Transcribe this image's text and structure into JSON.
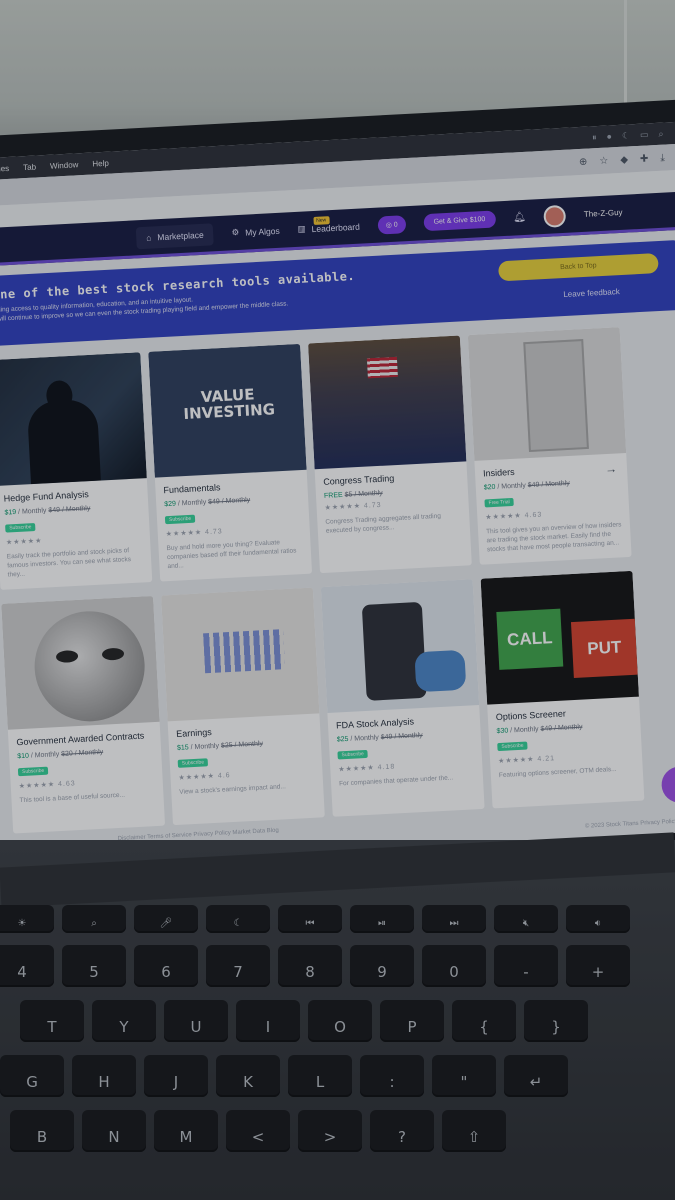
{
  "menubar": {
    "items": [
      "Profiles",
      "Tab",
      "Window",
      "Help"
    ]
  },
  "appnav": {
    "marketplace": "Marketplace",
    "my_algos": "My Algos",
    "leaderboard": "Leaderboard",
    "new_badge": "New",
    "points_count": "0",
    "promo": "Get & Give $100",
    "user_name": "The-Z-Guy"
  },
  "banner": {
    "headline": "o one of the best stock research tools available.",
    "sub_line1": "y providing access to quality information, education, and an intuitive layout.",
    "sub_line2": "r offer will continue to improve so we can even the stock trading playing field and empower the middle class.",
    "cta": "Back to Top",
    "feedback": "Leave feedback"
  },
  "cards": [
    {
      "title": "Hedge Fund Analysis",
      "price": "$19",
      "period": "/ Monthly",
      "strike": "$49 / Monthly",
      "tag": "Subscribe",
      "rating": "★★★★★",
      "desc": "Easily track the portfolio and stock picks of famous investors. You can see what stocks they..."
    },
    {
      "title": "Fundamentals",
      "price": "$29",
      "period": "/ Monthly",
      "strike": "$49 / Monthly",
      "tag": "Subscribe",
      "rating": "★★★★★  4.73",
      "desc": "Buy and hold more you thing? Evaluate companies based off their fundamental ratios and..."
    },
    {
      "title": "Congress Trading",
      "price": "FREE",
      "period": "",
      "strike": "$5 / Monthly",
      "tag": "",
      "rating": "★★★★★  4.73",
      "desc": "Congress Trading aggregates all trading executed by congress..."
    },
    {
      "title": "Insiders",
      "price": "$20",
      "period": "/ Monthly",
      "strike": "$49 / Monthly",
      "tag": "Free Trial",
      "rating": "★★★★★  4.63",
      "desc": "This tool gives you an overview of how insiders are trading the stock market. Easily find the stocks that have most people transacting an..."
    },
    {
      "title": "Government Awarded Contracts",
      "price": "$10",
      "period": "/ Monthly",
      "strike": "$20 / Monthly",
      "tag": "Subscribe",
      "rating": "★★★★★  4.63",
      "desc": "This tool is a base of useful source..."
    },
    {
      "title": "Earnings",
      "price": "$15",
      "period": "/ Monthly",
      "strike": "$25 / Monthly",
      "tag": "Subscribe",
      "rating": "★★★★★  4.6",
      "desc": "View a stock's earnings impact and..."
    },
    {
      "title": "FDA Stock Analysis",
      "price": "$25",
      "period": "/ Monthly",
      "strike": "$49 / Monthly",
      "tag": "Subscribe",
      "rating": "★★★★★  4.18",
      "desc": "For companies that operate under the..."
    },
    {
      "title": "Options Screener",
      "price": "$30",
      "period": "/ Monthly",
      "strike": "$49 / Monthly",
      "tag": "Subscribe",
      "rating": "★★★★★  4.21",
      "desc": "Featuring options screener, OTM deals..."
    }
  ],
  "thumb_text": {
    "value_investing": "VALUE INVESTING",
    "call": "CALL",
    "put": "PUT"
  },
  "footer": {
    "links": "Disclaimer  Terms of Service  Privacy Policy  Market Data  Blog",
    "copyright": "© 2023 Stock Titans  Privacy Policy"
  },
  "keyboard": {
    "row1": [
      "4",
      "5",
      "6",
      "7",
      "8",
      "9",
      "0",
      "-"
    ],
    "row2": [
      "T",
      "Y",
      "U",
      "I",
      "O",
      "P",
      "{"
    ],
    "row3": [
      "G",
      "H",
      "J",
      "K",
      "L",
      ":"
    ],
    "row4": [
      "B",
      "N",
      "M",
      "<",
      ">",
      "?"
    ]
  }
}
